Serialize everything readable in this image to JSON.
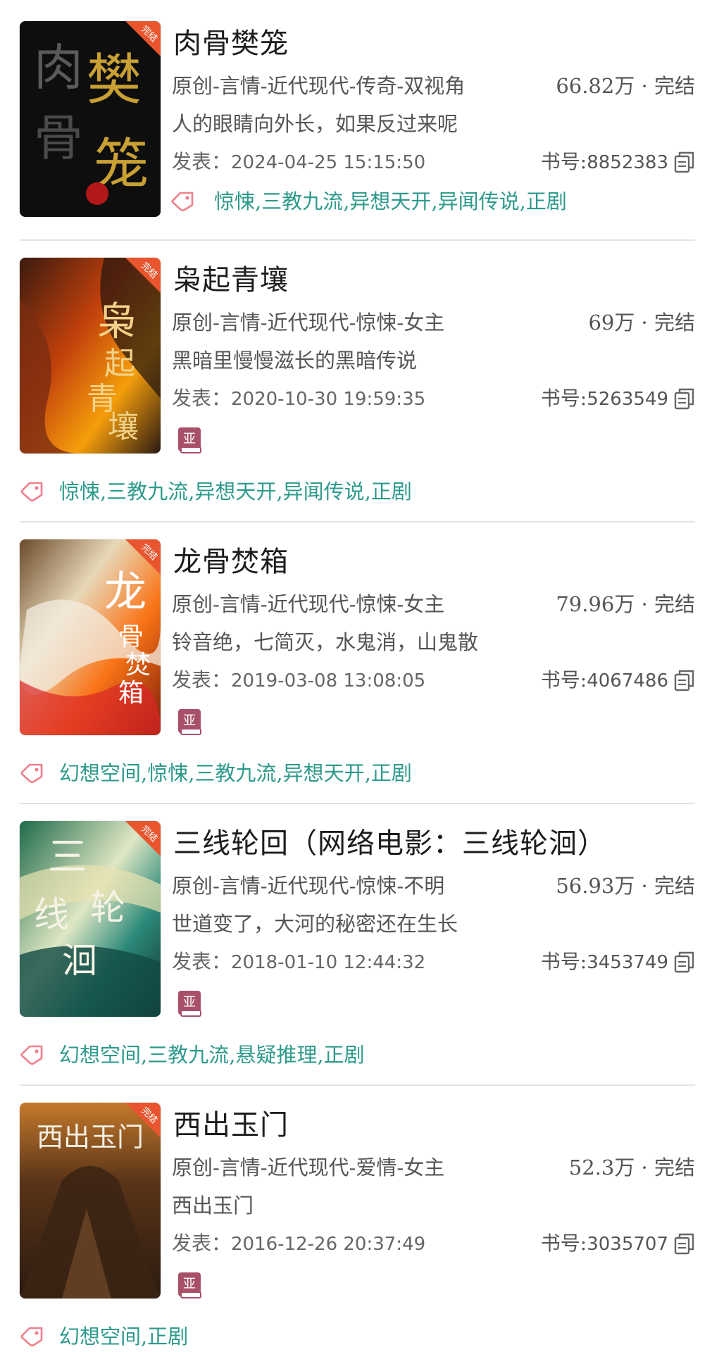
{
  "labels": {
    "published_prefix": "发表：",
    "bookid_prefix": "书号:",
    "finished_ribbon": "完结",
    "a_badge": "亚"
  },
  "books": [
    {
      "title": "肉骨樊笼",
      "category": "原创-言情-近代现代-传奇-双视角",
      "stat": "66.82万 · 完结",
      "summary": "人的眼睛向外长，如果反过来呢",
      "published": "2024-04-25  15:15:50",
      "book_id": "8852383",
      "tags": "惊悚,三教九流,异想天开,异闻传说,正剧",
      "cover_text": "肉骨樊笼"
    },
    {
      "title": "枭起青壤",
      "category": "原创-言情-近代现代-惊悚-女主",
      "stat": "69万 · 完结",
      "summary": "黑暗里慢慢滋长的黑暗传说",
      "published": "2020-10-30  19:59:35",
      "book_id": "5263549",
      "tags": "惊悚,三教九流,异想天开,异闻传说,正剧",
      "cover_text": "枭起青壤"
    },
    {
      "title": "龙骨焚箱",
      "category": "原创-言情-近代现代-惊悚-女主",
      "stat": "79.96万 · 完结",
      "summary": "铃音绝，七简灭，水鬼消，山鬼散",
      "published": "2019-03-08  13:08:05",
      "book_id": "4067486",
      "tags": "幻想空间,惊悚,三教九流,异想天开,正剧",
      "cover_text": "龙骨焚箱"
    },
    {
      "title": "三线轮回（网络电影：三线轮洄）",
      "category": "原创-言情-近代现代-惊悚-不明",
      "stat": "56.93万 · 完结",
      "summary": "世道变了，大河的秘密还在生长",
      "published": "2018-01-10  12:44:32",
      "book_id": "3453749",
      "tags": "幻想空间,三教九流,悬疑推理,正剧",
      "cover_text": "三线轮洄"
    },
    {
      "title": "西出玉门",
      "category": "原创-言情-近代现代-爱情-女主",
      "stat": "52.3万 · 完结",
      "summary": "西出玉门",
      "published": "2016-12-26  20:37:49",
      "book_id": "3035707",
      "tags": "幻想空间,正剧",
      "cover_text": "西出玉门"
    }
  ],
  "colors": {
    "tag_text": "#2e9a8c",
    "tag_icon": "#f07f8d",
    "ribbon": "#e8552e",
    "badge": "#a8506a",
    "divider": "#e3e3e3"
  },
  "icons": {
    "tag": "tag-icon",
    "copy": "copy-icon",
    "badge": "book-badge-icon"
  }
}
